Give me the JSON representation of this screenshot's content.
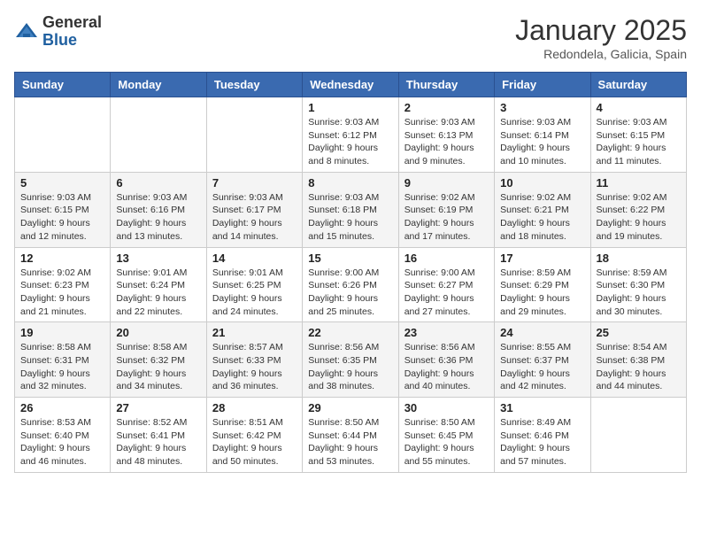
{
  "header": {
    "logo": {
      "line1": "General",
      "line2": "Blue"
    },
    "title": "January 2025",
    "location": "Redondela, Galicia, Spain"
  },
  "weekdays": [
    "Sunday",
    "Monday",
    "Tuesday",
    "Wednesday",
    "Thursday",
    "Friday",
    "Saturday"
  ],
  "weeks": [
    [
      {
        "day": "",
        "info": ""
      },
      {
        "day": "",
        "info": ""
      },
      {
        "day": "",
        "info": ""
      },
      {
        "day": "1",
        "info": "Sunrise: 9:03 AM\nSunset: 6:12 PM\nDaylight: 9 hours\nand 8 minutes."
      },
      {
        "day": "2",
        "info": "Sunrise: 9:03 AM\nSunset: 6:13 PM\nDaylight: 9 hours\nand 9 minutes."
      },
      {
        "day": "3",
        "info": "Sunrise: 9:03 AM\nSunset: 6:14 PM\nDaylight: 9 hours\nand 10 minutes."
      },
      {
        "day": "4",
        "info": "Sunrise: 9:03 AM\nSunset: 6:15 PM\nDaylight: 9 hours\nand 11 minutes."
      }
    ],
    [
      {
        "day": "5",
        "info": "Sunrise: 9:03 AM\nSunset: 6:15 PM\nDaylight: 9 hours\nand 12 minutes."
      },
      {
        "day": "6",
        "info": "Sunrise: 9:03 AM\nSunset: 6:16 PM\nDaylight: 9 hours\nand 13 minutes."
      },
      {
        "day": "7",
        "info": "Sunrise: 9:03 AM\nSunset: 6:17 PM\nDaylight: 9 hours\nand 14 minutes."
      },
      {
        "day": "8",
        "info": "Sunrise: 9:03 AM\nSunset: 6:18 PM\nDaylight: 9 hours\nand 15 minutes."
      },
      {
        "day": "9",
        "info": "Sunrise: 9:02 AM\nSunset: 6:19 PM\nDaylight: 9 hours\nand 17 minutes."
      },
      {
        "day": "10",
        "info": "Sunrise: 9:02 AM\nSunset: 6:21 PM\nDaylight: 9 hours\nand 18 minutes."
      },
      {
        "day": "11",
        "info": "Sunrise: 9:02 AM\nSunset: 6:22 PM\nDaylight: 9 hours\nand 19 minutes."
      }
    ],
    [
      {
        "day": "12",
        "info": "Sunrise: 9:02 AM\nSunset: 6:23 PM\nDaylight: 9 hours\nand 21 minutes."
      },
      {
        "day": "13",
        "info": "Sunrise: 9:01 AM\nSunset: 6:24 PM\nDaylight: 9 hours\nand 22 minutes."
      },
      {
        "day": "14",
        "info": "Sunrise: 9:01 AM\nSunset: 6:25 PM\nDaylight: 9 hours\nand 24 minutes."
      },
      {
        "day": "15",
        "info": "Sunrise: 9:00 AM\nSunset: 6:26 PM\nDaylight: 9 hours\nand 25 minutes."
      },
      {
        "day": "16",
        "info": "Sunrise: 9:00 AM\nSunset: 6:27 PM\nDaylight: 9 hours\nand 27 minutes."
      },
      {
        "day": "17",
        "info": "Sunrise: 8:59 AM\nSunset: 6:29 PM\nDaylight: 9 hours\nand 29 minutes."
      },
      {
        "day": "18",
        "info": "Sunrise: 8:59 AM\nSunset: 6:30 PM\nDaylight: 9 hours\nand 30 minutes."
      }
    ],
    [
      {
        "day": "19",
        "info": "Sunrise: 8:58 AM\nSunset: 6:31 PM\nDaylight: 9 hours\nand 32 minutes."
      },
      {
        "day": "20",
        "info": "Sunrise: 8:58 AM\nSunset: 6:32 PM\nDaylight: 9 hours\nand 34 minutes."
      },
      {
        "day": "21",
        "info": "Sunrise: 8:57 AM\nSunset: 6:33 PM\nDaylight: 9 hours\nand 36 minutes."
      },
      {
        "day": "22",
        "info": "Sunrise: 8:56 AM\nSunset: 6:35 PM\nDaylight: 9 hours\nand 38 minutes."
      },
      {
        "day": "23",
        "info": "Sunrise: 8:56 AM\nSunset: 6:36 PM\nDaylight: 9 hours\nand 40 minutes."
      },
      {
        "day": "24",
        "info": "Sunrise: 8:55 AM\nSunset: 6:37 PM\nDaylight: 9 hours\nand 42 minutes."
      },
      {
        "day": "25",
        "info": "Sunrise: 8:54 AM\nSunset: 6:38 PM\nDaylight: 9 hours\nand 44 minutes."
      }
    ],
    [
      {
        "day": "26",
        "info": "Sunrise: 8:53 AM\nSunset: 6:40 PM\nDaylight: 9 hours\nand 46 minutes."
      },
      {
        "day": "27",
        "info": "Sunrise: 8:52 AM\nSunset: 6:41 PM\nDaylight: 9 hours\nand 48 minutes."
      },
      {
        "day": "28",
        "info": "Sunrise: 8:51 AM\nSunset: 6:42 PM\nDaylight: 9 hours\nand 50 minutes."
      },
      {
        "day": "29",
        "info": "Sunrise: 8:50 AM\nSunset: 6:44 PM\nDaylight: 9 hours\nand 53 minutes."
      },
      {
        "day": "30",
        "info": "Sunrise: 8:50 AM\nSunset: 6:45 PM\nDaylight: 9 hours\nand 55 minutes."
      },
      {
        "day": "31",
        "info": "Sunrise: 8:49 AM\nSunset: 6:46 PM\nDaylight: 9 hours\nand 57 minutes."
      },
      {
        "day": "",
        "info": ""
      }
    ]
  ]
}
